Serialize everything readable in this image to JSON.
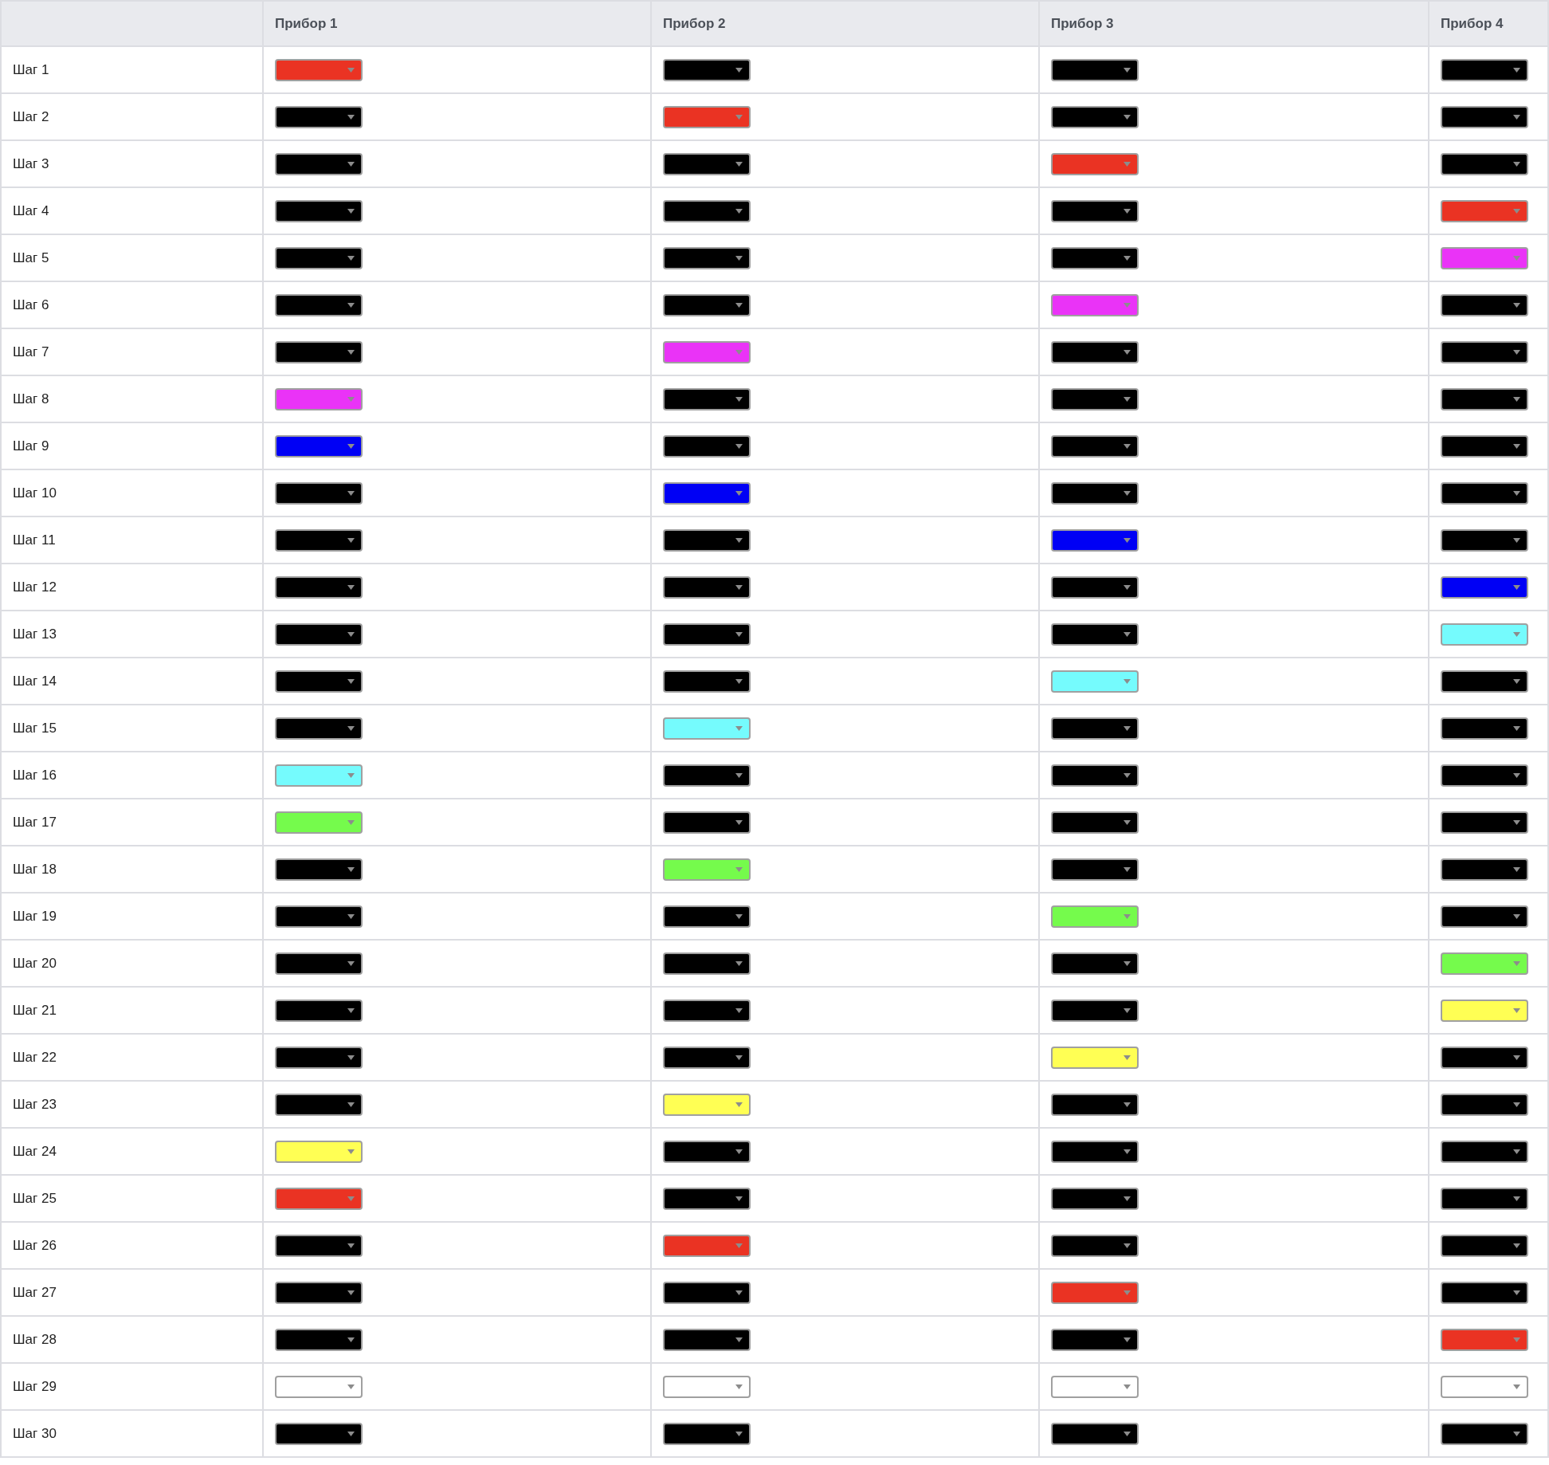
{
  "table": {
    "columns": [
      "Прибор 1",
      "Прибор 2",
      "Прибор 3",
      "Прибор 4"
    ],
    "rows": [
      {
        "label": "Шаг 1",
        "cells": [
          {
            "color": "#ea3323"
          },
          {
            "color": "#000000"
          },
          {
            "color": "#000000"
          },
          {
            "color": "#000000"
          }
        ]
      },
      {
        "label": "Шаг 2",
        "cells": [
          {
            "color": "#000000"
          },
          {
            "color": "#ea3323"
          },
          {
            "color": "#000000"
          },
          {
            "color": "#000000"
          }
        ]
      },
      {
        "label": "Шаг 3",
        "cells": [
          {
            "color": "#000000"
          },
          {
            "color": "#000000"
          },
          {
            "color": "#ea3323"
          },
          {
            "color": "#000000"
          }
        ]
      },
      {
        "label": "Шаг 4",
        "cells": [
          {
            "color": "#000000"
          },
          {
            "color": "#000000"
          },
          {
            "color": "#000000"
          },
          {
            "color": "#ea3323"
          }
        ]
      },
      {
        "label": "Шаг 5",
        "cells": [
          {
            "color": "#000000"
          },
          {
            "color": "#000000"
          },
          {
            "color": "#000000"
          },
          {
            "color": "#ea33f7"
          }
        ]
      },
      {
        "label": "Шаг 6",
        "cells": [
          {
            "color": "#000000"
          },
          {
            "color": "#000000"
          },
          {
            "color": "#ea33f7"
          },
          {
            "color": "#000000"
          }
        ]
      },
      {
        "label": "Шаг 7",
        "cells": [
          {
            "color": "#000000"
          },
          {
            "color": "#ea33f7"
          },
          {
            "color": "#000000"
          },
          {
            "color": "#000000"
          }
        ]
      },
      {
        "label": "Шаг 8",
        "cells": [
          {
            "color": "#ea33f7"
          },
          {
            "color": "#000000"
          },
          {
            "color": "#000000"
          },
          {
            "color": "#000000"
          }
        ]
      },
      {
        "label": "Шаг 9",
        "cells": [
          {
            "color": "#0000f5"
          },
          {
            "color": "#000000"
          },
          {
            "color": "#000000"
          },
          {
            "color": "#000000"
          }
        ]
      },
      {
        "label": "Шаг 10",
        "cells": [
          {
            "color": "#000000"
          },
          {
            "color": "#0000f5"
          },
          {
            "color": "#000000"
          },
          {
            "color": "#000000"
          }
        ]
      },
      {
        "label": "Шаг 11",
        "cells": [
          {
            "color": "#000000"
          },
          {
            "color": "#000000"
          },
          {
            "color": "#0000f5"
          },
          {
            "color": "#000000"
          }
        ]
      },
      {
        "label": "Шаг 12",
        "cells": [
          {
            "color": "#000000"
          },
          {
            "color": "#000000"
          },
          {
            "color": "#000000"
          },
          {
            "color": "#0000f5"
          }
        ]
      },
      {
        "label": "Шаг 13",
        "cells": [
          {
            "color": "#000000"
          },
          {
            "color": "#000000"
          },
          {
            "color": "#000000"
          },
          {
            "color": "#75fbfd"
          }
        ]
      },
      {
        "label": "Шаг 14",
        "cells": [
          {
            "color": "#000000"
          },
          {
            "color": "#000000"
          },
          {
            "color": "#75fbfd"
          },
          {
            "color": "#000000"
          }
        ]
      },
      {
        "label": "Шаг 15",
        "cells": [
          {
            "color": "#000000"
          },
          {
            "color": "#75fbfd"
          },
          {
            "color": "#000000"
          },
          {
            "color": "#000000"
          }
        ]
      },
      {
        "label": "Шаг 16",
        "cells": [
          {
            "color": "#75fbfd"
          },
          {
            "color": "#000000"
          },
          {
            "color": "#000000"
          },
          {
            "color": "#000000"
          }
        ]
      },
      {
        "label": "Шаг 17",
        "cells": [
          {
            "color": "#75fb4c"
          },
          {
            "color": "#000000"
          },
          {
            "color": "#000000"
          },
          {
            "color": "#000000"
          }
        ]
      },
      {
        "label": "Шаг 18",
        "cells": [
          {
            "color": "#000000"
          },
          {
            "color": "#75fb4c"
          },
          {
            "color": "#000000"
          },
          {
            "color": "#000000"
          }
        ]
      },
      {
        "label": "Шаг 19",
        "cells": [
          {
            "color": "#000000"
          },
          {
            "color": "#000000"
          },
          {
            "color": "#75fb4c"
          },
          {
            "color": "#000000"
          }
        ]
      },
      {
        "label": "Шаг 20",
        "cells": [
          {
            "color": "#000000"
          },
          {
            "color": "#000000"
          },
          {
            "color": "#000000"
          },
          {
            "color": "#75fb4c"
          }
        ]
      },
      {
        "label": "Шаг 21",
        "cells": [
          {
            "color": "#000000"
          },
          {
            "color": "#000000"
          },
          {
            "color": "#000000"
          },
          {
            "color": "#ffff54"
          }
        ]
      },
      {
        "label": "Шаг 22",
        "cells": [
          {
            "color": "#000000"
          },
          {
            "color": "#000000"
          },
          {
            "color": "#ffff54"
          },
          {
            "color": "#000000"
          }
        ]
      },
      {
        "label": "Шаг 23",
        "cells": [
          {
            "color": "#000000"
          },
          {
            "color": "#ffff54"
          },
          {
            "color": "#000000"
          },
          {
            "color": "#000000"
          }
        ]
      },
      {
        "label": "Шаг 24",
        "cells": [
          {
            "color": "#ffff54"
          },
          {
            "color": "#000000"
          },
          {
            "color": "#000000"
          },
          {
            "color": "#000000"
          }
        ]
      },
      {
        "label": "Шаг 25",
        "cells": [
          {
            "color": "#ea3323"
          },
          {
            "color": "#000000"
          },
          {
            "color": "#000000"
          },
          {
            "color": "#000000"
          }
        ]
      },
      {
        "label": "Шаг 26",
        "cells": [
          {
            "color": "#000000"
          },
          {
            "color": "#ea3323"
          },
          {
            "color": "#000000"
          },
          {
            "color": "#000000"
          }
        ]
      },
      {
        "label": "Шаг 27",
        "cells": [
          {
            "color": "#000000"
          },
          {
            "color": "#000000"
          },
          {
            "color": "#ea3323"
          },
          {
            "color": "#000000"
          }
        ]
      },
      {
        "label": "Шаг 28",
        "cells": [
          {
            "color": "#000000"
          },
          {
            "color": "#000000"
          },
          {
            "color": "#000000"
          },
          {
            "color": "#ea3323"
          }
        ]
      },
      {
        "label": "Шаг 29",
        "cells": [
          {
            "color": "#ffffff"
          },
          {
            "color": "#ffffff"
          },
          {
            "color": "#ffffff"
          },
          {
            "color": "#ffffff"
          }
        ]
      },
      {
        "label": "Шаг 30",
        "cells": [
          {
            "color": "#000000"
          },
          {
            "color": "#000000"
          },
          {
            "color": "#000000"
          },
          {
            "color": "#000000"
          }
        ]
      }
    ]
  }
}
